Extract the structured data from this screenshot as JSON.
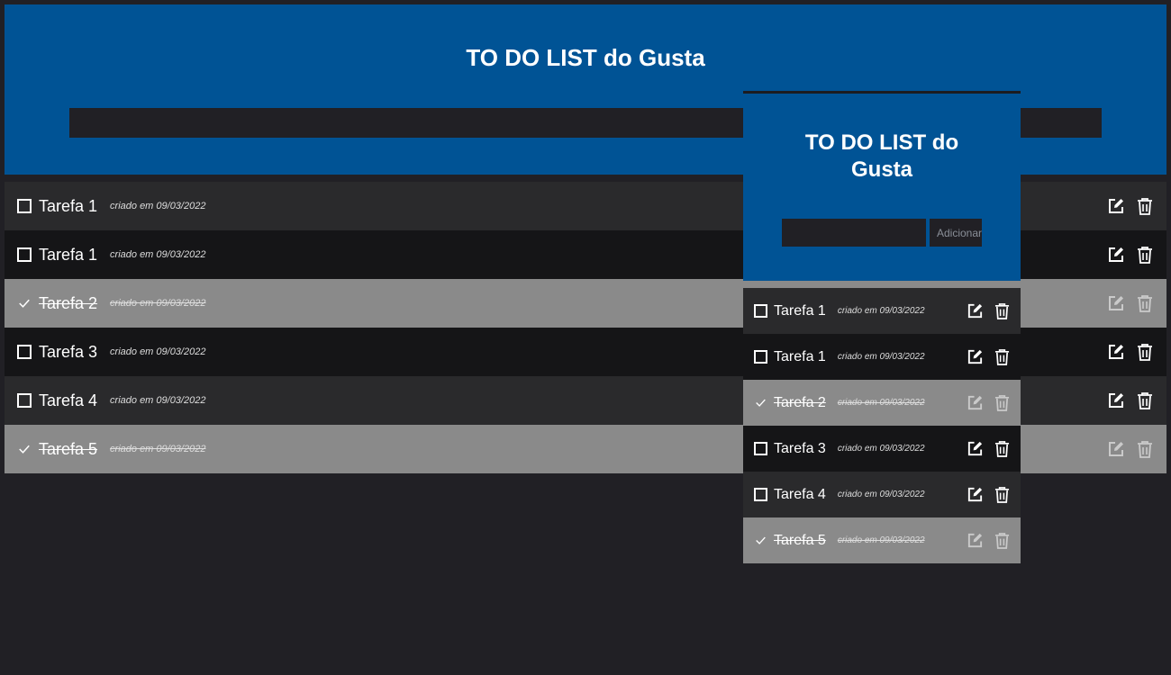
{
  "app": {
    "title": "TO DO LIST do Gusta",
    "task_input_value": "",
    "add_button_label": "Adicionar"
  },
  "tasks": [
    {
      "name": "Tarefa 1",
      "created": "criado em 09/03/2022",
      "done": false
    },
    {
      "name": "Tarefa 1",
      "created": "criado em 09/03/2022",
      "done": false
    },
    {
      "name": "Tarefa 2",
      "created": "criado em 09/03/2022",
      "done": true
    },
    {
      "name": "Tarefa 3",
      "created": "criado em 09/03/2022",
      "done": false
    },
    {
      "name": "Tarefa 4",
      "created": "criado em 09/03/2022",
      "done": false
    },
    {
      "name": "Tarefa 5",
      "created": "criado em 09/03/2022",
      "done": true
    }
  ],
  "icons": {
    "check": "checkbox-icon",
    "edit": "edit-icon",
    "delete": "trash-icon"
  },
  "colors": {
    "header_bg": "#005395",
    "page_bg": "#212025",
    "row_light": "#2a2a2c",
    "row_dark": "#151517",
    "row_done": "#8a8a8a"
  }
}
